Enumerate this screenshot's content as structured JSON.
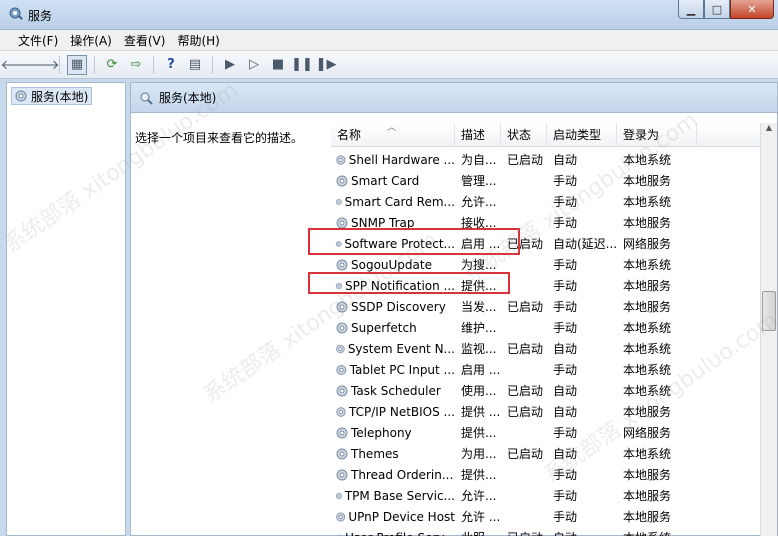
{
  "window": {
    "title": "服务"
  },
  "menu": [
    "文件(F)",
    "操作(A)",
    "查看(V)",
    "帮助(H)"
  ],
  "left_pane": {
    "tree_item": "服务(本地)"
  },
  "right_pane": {
    "header": "服务(本地)",
    "description_prompt": "选择一个项目来查看它的描述。"
  },
  "columns": {
    "name": "名称",
    "desc": "描述",
    "status": "状态",
    "startup": "启动类型",
    "logon": "登录为"
  },
  "services": [
    {
      "name": "Shell Hardware ...",
      "desc": "为自...",
      "status": "已启动",
      "startup": "自动",
      "logon": "本地系统"
    },
    {
      "name": "Smart Card",
      "desc": "管理...",
      "status": "",
      "startup": "手动",
      "logon": "本地服务"
    },
    {
      "name": "Smart Card Rem...",
      "desc": "允许...",
      "status": "",
      "startup": "手动",
      "logon": "本地系统"
    },
    {
      "name": "SNMP Trap",
      "desc": "接收...",
      "status": "",
      "startup": "手动",
      "logon": "本地服务"
    },
    {
      "name": "Software Protect...",
      "desc": "启用 ...",
      "status": "已启动",
      "startup": "自动(延迟...",
      "logon": "网络服务"
    },
    {
      "name": "SogouUpdate",
      "desc": "为搜...",
      "status": "",
      "startup": "手动",
      "logon": "本地系统"
    },
    {
      "name": "SPP Notification ...",
      "desc": "提供...",
      "status": "",
      "startup": "手动",
      "logon": "本地服务"
    },
    {
      "name": "SSDP Discovery",
      "desc": "当发...",
      "status": "已启动",
      "startup": "手动",
      "logon": "本地服务"
    },
    {
      "name": "Superfetch",
      "desc": "维护...",
      "status": "",
      "startup": "手动",
      "logon": "本地系统"
    },
    {
      "name": "System Event N...",
      "desc": "监视...",
      "status": "已启动",
      "startup": "自动",
      "logon": "本地系统"
    },
    {
      "name": "Tablet PC Input ...",
      "desc": "启用 ...",
      "status": "",
      "startup": "手动",
      "logon": "本地系统"
    },
    {
      "name": "Task Scheduler",
      "desc": "使用...",
      "status": "已启动",
      "startup": "自动",
      "logon": "本地系统"
    },
    {
      "name": "TCP/IP NetBIOS ...",
      "desc": "提供 ...",
      "status": "已启动",
      "startup": "自动",
      "logon": "本地服务"
    },
    {
      "name": "Telephony",
      "desc": "提供...",
      "status": "",
      "startup": "手动",
      "logon": "网络服务"
    },
    {
      "name": "Themes",
      "desc": "为用...",
      "status": "已启动",
      "startup": "自动",
      "logon": "本地系统"
    },
    {
      "name": "Thread Orderin...",
      "desc": "提供...",
      "status": "",
      "startup": "手动",
      "logon": "本地服务"
    },
    {
      "name": "TPM Base Servic...",
      "desc": "允许...",
      "status": "",
      "startup": "手动",
      "logon": "本地服务"
    },
    {
      "name": "UPnP Device Host",
      "desc": "允许 ...",
      "status": "",
      "startup": "手动",
      "logon": "本地服务"
    },
    {
      "name": "User Profile Serv...",
      "desc": "此服...",
      "status": "已启动",
      "startup": "自动",
      "logon": "本地系统"
    }
  ],
  "highlighted_services": [
    "Software Protect...",
    "SPP Notification ..."
  ],
  "watermark": "系统部落 xitongbuluo.com",
  "colors": {
    "highlight_border": "#d8333a",
    "header_bg": "#c3d6ec"
  }
}
